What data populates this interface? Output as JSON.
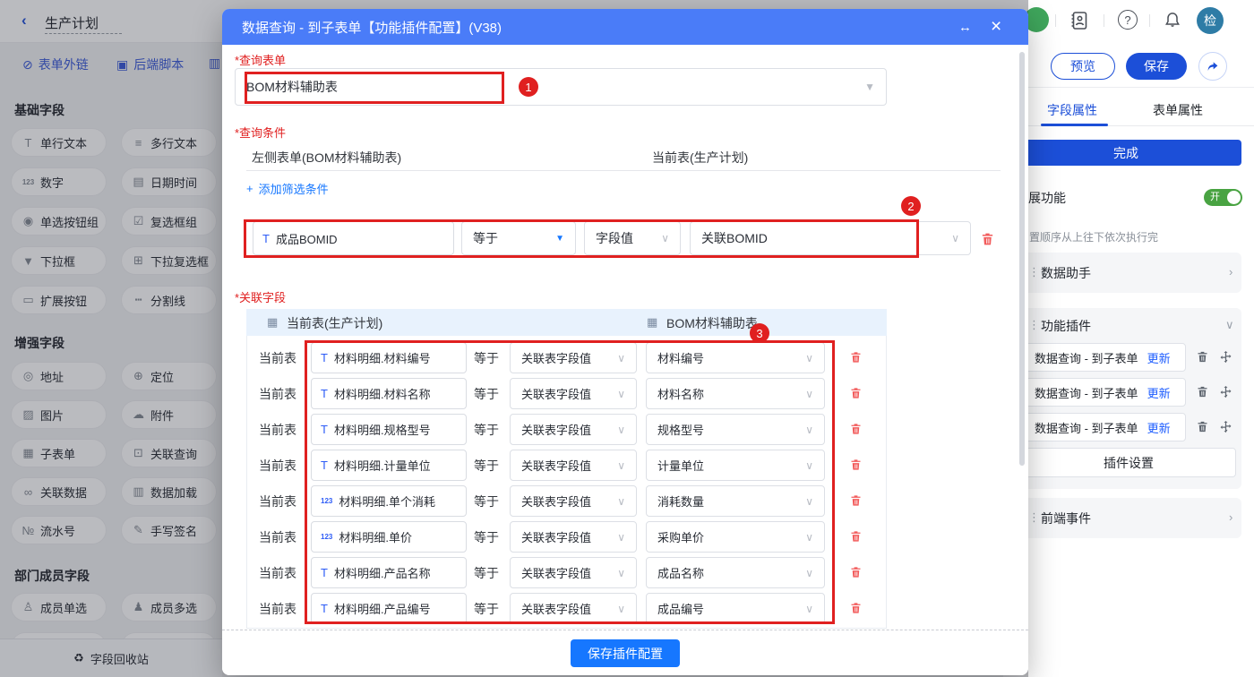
{
  "colors": {
    "modal_header_blue": "#4a7cf8",
    "accent_blue": "#1677ff",
    "panel_dark_blue": "#1c4fd8",
    "annotation_red": "#e02020",
    "trash_red": "#f25c5c",
    "toggle_green": "#49a342",
    "avatar_teal": "#2e7ca6"
  },
  "topbar": {
    "back_title": "生产计划",
    "toolbar": [
      {
        "icon": "⊘",
        "label": "表单外链"
      },
      {
        "icon": "▣",
        "label": "后端脚本"
      },
      {
        "icon": "▥",
        "label": ""
      }
    ]
  },
  "sidebar": {
    "sections": [
      {
        "title": "基础字段",
        "items": [
          {
            "icon": "T",
            "label": "单行文本"
          },
          {
            "icon": "≡",
            "label": "多行文本"
          },
          {
            "icon": "123",
            "label": "数字"
          },
          {
            "icon": "▤",
            "label": "日期时间"
          },
          {
            "icon": "◉",
            "label": "单选按钮组"
          },
          {
            "icon": "☑",
            "label": "复选框组"
          },
          {
            "icon": "▼",
            "label": "下拉框"
          },
          {
            "icon": "⊞",
            "label": "下拉复选框"
          },
          {
            "icon": "▭",
            "label": "扩展按钮"
          },
          {
            "icon": "┅",
            "label": "分割线"
          }
        ]
      },
      {
        "title": "增强字段",
        "items": [
          {
            "icon": "◎",
            "label": "地址"
          },
          {
            "icon": "⊕",
            "label": "定位"
          },
          {
            "icon": "▨",
            "label": "图片"
          },
          {
            "icon": "☁",
            "label": "附件"
          },
          {
            "icon": "▦",
            "label": "子表单"
          },
          {
            "icon": "⊡",
            "label": "关联查询"
          },
          {
            "icon": "∞",
            "label": "关联数据"
          },
          {
            "icon": "▥",
            "label": "数据加载"
          },
          {
            "icon": "№",
            "label": "流水号"
          },
          {
            "icon": "✎",
            "label": "手写签名"
          }
        ]
      },
      {
        "title": "部门成员字段",
        "items": [
          {
            "icon": "♙",
            "label": "成员单选"
          },
          {
            "icon": "♟",
            "label": "成员多选"
          }
        ]
      }
    ],
    "recycle_label": "字段回收站",
    "recycle_icon": "♻"
  },
  "modal": {
    "title": "数据查询 - 到子表单【功能插件配置】(V38)",
    "expand_icon": "↔",
    "close_icon": "×",
    "query_form": {
      "label": "*查询表单",
      "value": "BOM材料辅助表",
      "badge": "1"
    },
    "query_condition": {
      "label": "*查询条件",
      "col_left": "左侧表单(BOM材料辅助表)",
      "col_right": "当前表(生产计划)",
      "add_link": "添加筛选条件",
      "badge": "2",
      "row": {
        "icon": "T",
        "field": "成品BOMID",
        "op": "等于",
        "value_type": "字段值",
        "value": "关联BOMID"
      }
    },
    "related_fields": {
      "label": "*关联字段",
      "col_left": "当前表(生产计划)",
      "col_right": "BOM材料辅助表",
      "badge": "3",
      "rows": [
        {
          "prefix": "当前表",
          "icon": "T",
          "left": "材料明细.材料编号",
          "op": "等于",
          "mid": "关联表字段值",
          "right": "材料编号"
        },
        {
          "prefix": "当前表",
          "icon": "T",
          "left": "材料明细.材料名称",
          "op": "等于",
          "mid": "关联表字段值",
          "right": "材料名称"
        },
        {
          "prefix": "当前表",
          "icon": "T",
          "left": "材料明细.规格型号",
          "op": "等于",
          "mid": "关联表字段值",
          "right": "规格型号"
        },
        {
          "prefix": "当前表",
          "icon": "T",
          "left": "材料明细.计量单位",
          "op": "等于",
          "mid": "关联表字段值",
          "right": "计量单位"
        },
        {
          "prefix": "当前表",
          "icon": "123",
          "left": "材料明细.单个消耗",
          "op": "等于",
          "mid": "关联表字段值",
          "right": "消耗数量"
        },
        {
          "prefix": "当前表",
          "icon": "123",
          "left": "材料明细.单价",
          "op": "等于",
          "mid": "关联表字段值",
          "right": "采购单价"
        },
        {
          "prefix": "当前表",
          "icon": "T",
          "left": "材料明细.产品名称",
          "op": "等于",
          "mid": "关联表字段值",
          "right": "成品名称"
        },
        {
          "prefix": "当前表",
          "icon": "T",
          "left": "材料明细.产品编号",
          "op": "等于",
          "mid": "关联表字段值",
          "right": "成品编号"
        }
      ]
    },
    "footer_button": "保存插件配置"
  },
  "right_panel": {
    "help_icon": "?",
    "avatar": "检",
    "preview": "预览",
    "save": "保存",
    "tabs": [
      "字段属性",
      "表单属性"
    ],
    "done": "完成",
    "extend_label": "展功能",
    "toggle_on": "开",
    "hint": "置顺序从上往下依次执行完",
    "data_helper": "数据助手",
    "plugins_title": "功能插件",
    "plugin_items": [
      {
        "name": "数据查询 - 到子表单",
        "action": "更新"
      },
      {
        "name": "数据查询 - 到子表单",
        "action": "更新"
      },
      {
        "name": "数据查询 - 到子表单",
        "action": "更新"
      }
    ],
    "plugin_settings": "插件设置",
    "frontend_events": "前端事件",
    "chevron_right": "›",
    "chevron_down": "∨"
  }
}
